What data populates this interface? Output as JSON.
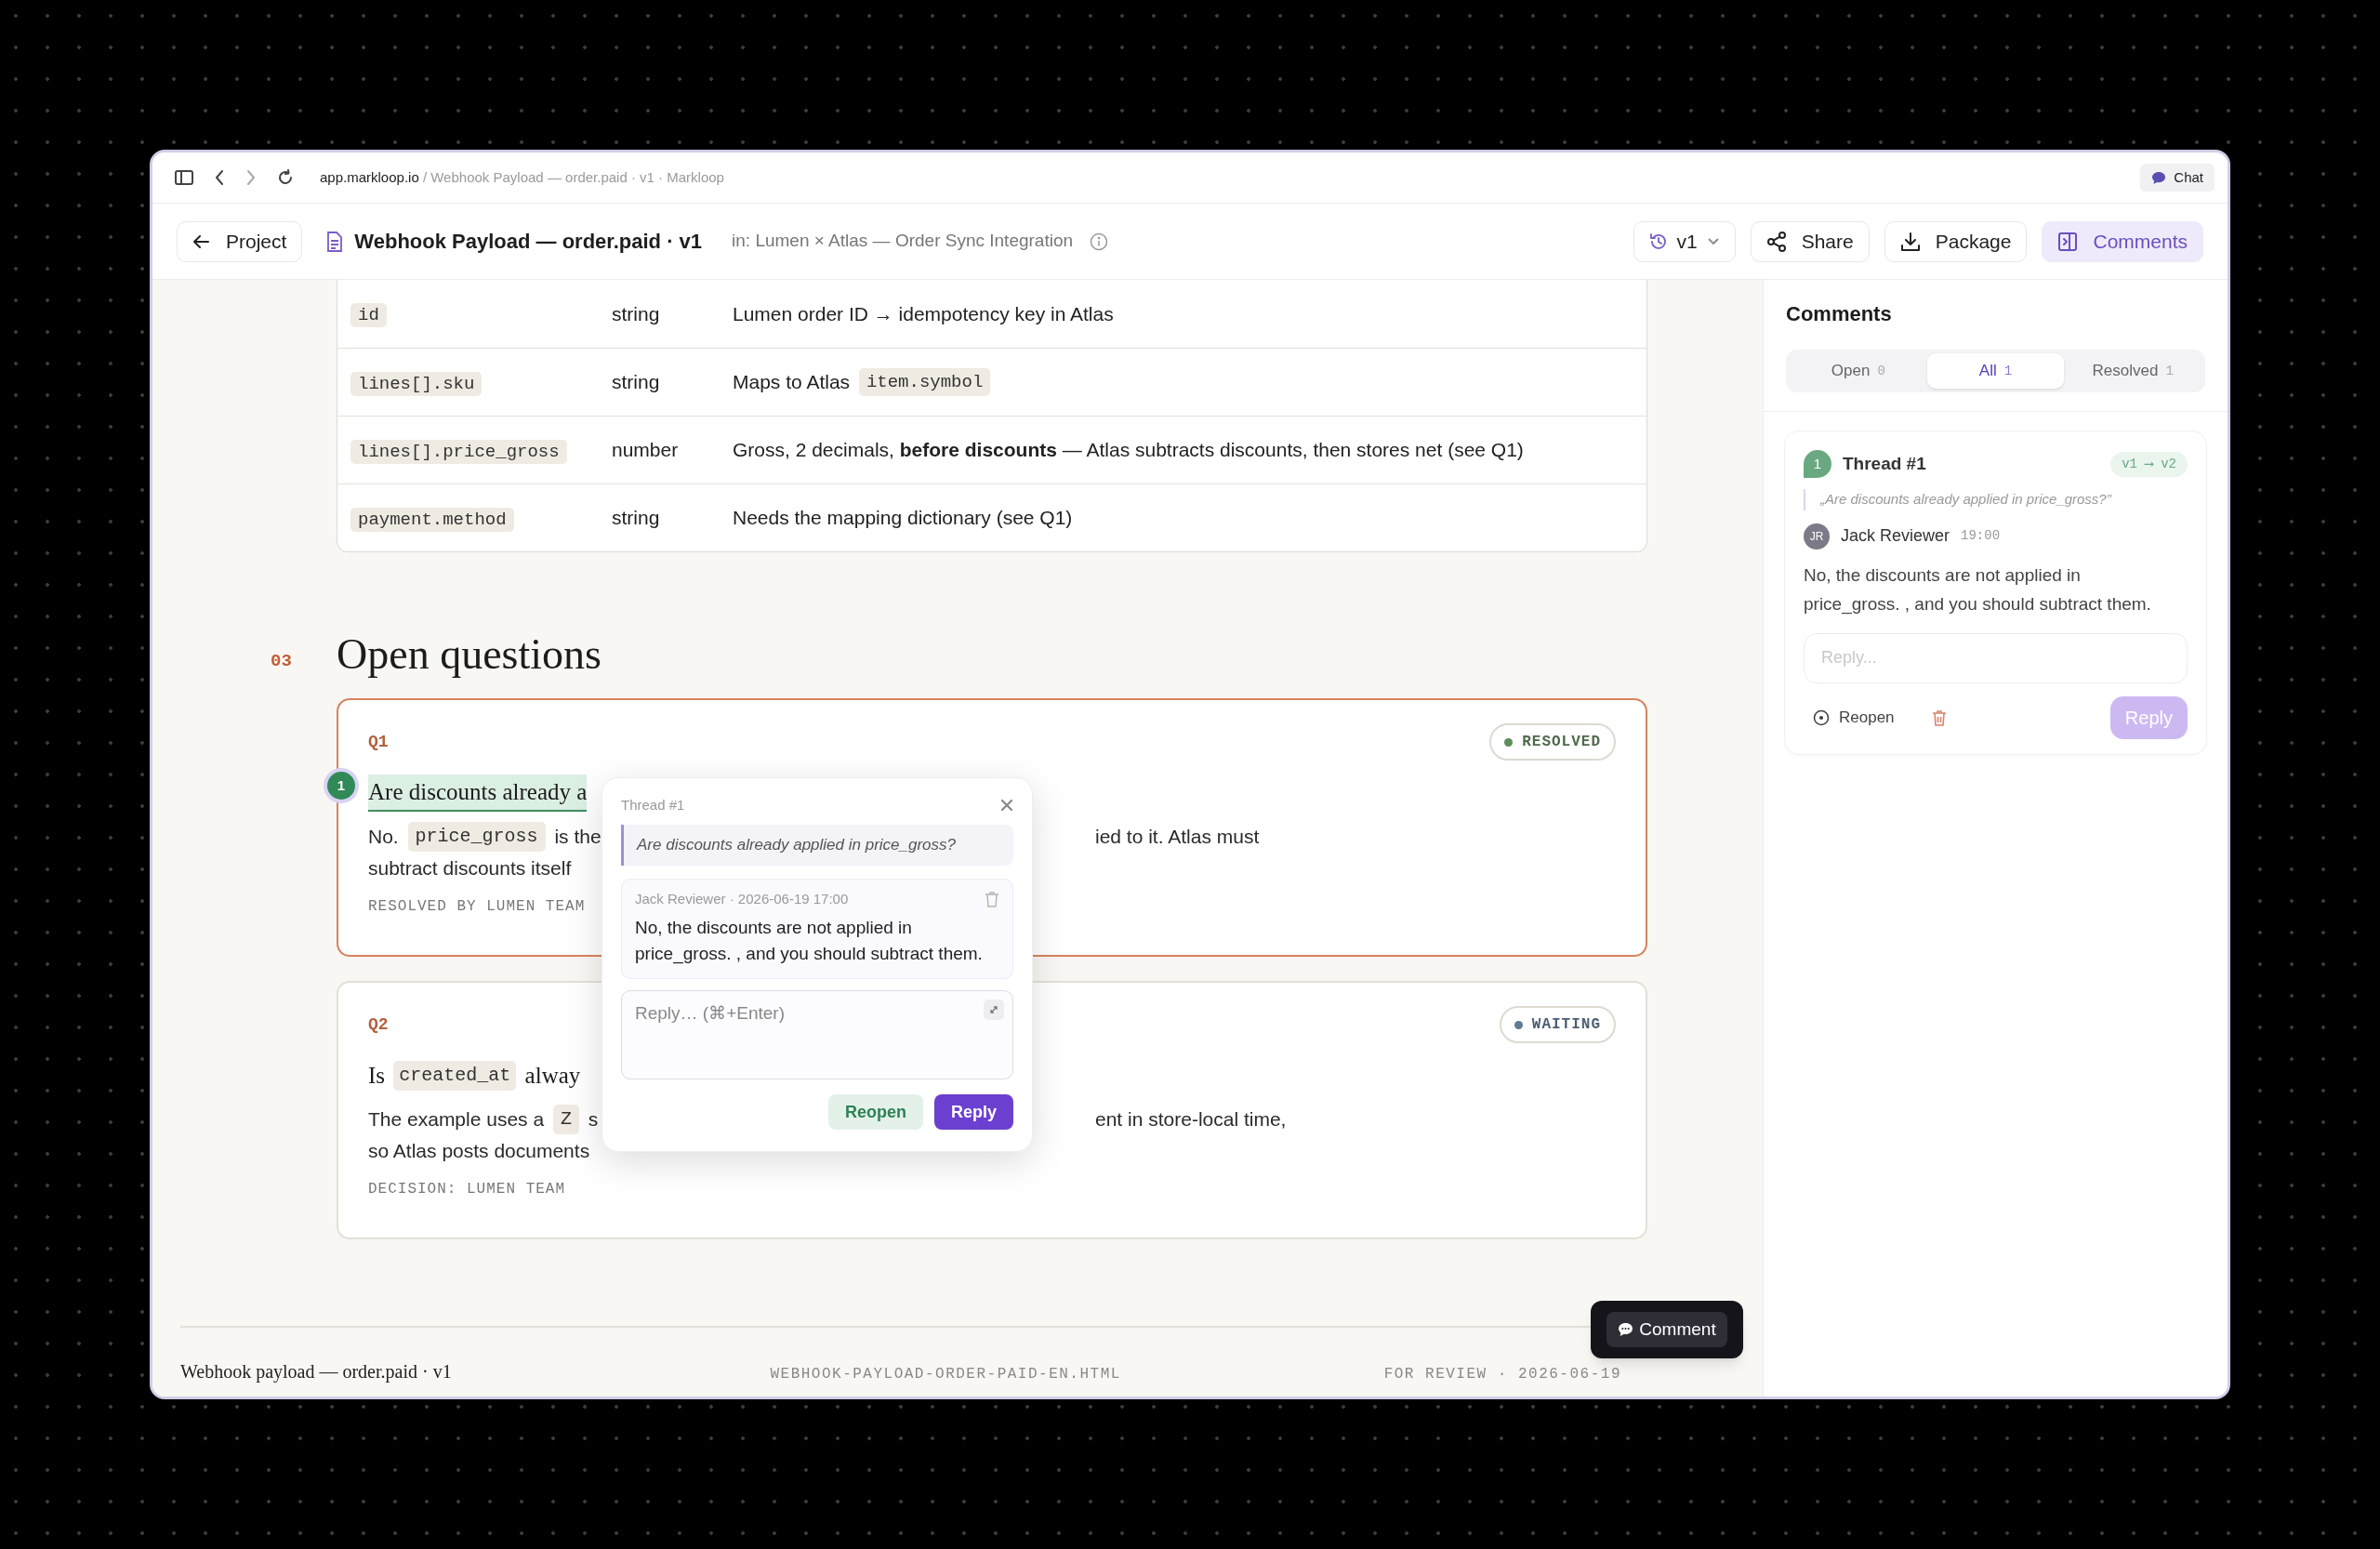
{
  "browser": {
    "host": "app.markloop.io",
    "path": "/ Webhook Payload — order.paid · v1 · Markloop",
    "chat_label": "Chat"
  },
  "header": {
    "back_label": "Project",
    "doc_title": "Webhook Payload — order.paid · v1",
    "context": "in: Lumen × Atlas — Order Sync Integration",
    "version": "v1",
    "actions": [
      {
        "kind": "share",
        "label": "Share",
        "selected": false
      },
      {
        "kind": "package",
        "label": "Package",
        "selected": false
      },
      {
        "kind": "comments",
        "label": "Comments",
        "selected": true
      }
    ]
  },
  "fields_table": {
    "rows": [
      {
        "field": "id",
        "type": "string",
        "description": [
          {
            "text": "Lumen order ID → idempotency key in Atlas"
          }
        ]
      },
      {
        "field": "lines[].sku",
        "type": "string",
        "description": [
          {
            "text": "Maps to Atlas "
          },
          {
            "code": "item.symbol"
          }
        ]
      },
      {
        "field": "lines[].price_gross",
        "type": "number",
        "description": [
          {
            "text": "Gross, 2 decimals, **before discounts** — Atlas subtracts discounts, then stores net (see Q1)"
          }
        ]
      },
      {
        "field": "payment.method",
        "type": "string",
        "description": [
          {
            "text": "Needs the mapping dictionary (see Q1)"
          }
        ]
      }
    ]
  },
  "section": {
    "number": "03",
    "title": "Open questions"
  },
  "questions": [
    {
      "label": "Q1",
      "focused": true,
      "highlighted": true,
      "thread_badge": "1",
      "status": {
        "kind": "resolved",
        "label": "RESOLVED"
      },
      "title": [
        {
          "text": "Are discounts already a"
        }
      ],
      "body": [
        {
          "left": [
            {
              "text": "No. "
            },
            {
              "code": "price_gross"
            },
            {
              "text": " is the"
            }
          ],
          "right": [
            {
              "text": "ied to it. Atlas must"
            }
          ]
        },
        {
          "left": [
            {
              "text": "subtract discounts itself"
            }
          ]
        }
      ],
      "footer": "RESOLVED BY LUMEN TEAM"
    },
    {
      "label": "Q2",
      "focused": false,
      "highlighted": false,
      "status": {
        "kind": "waiting",
        "label": "WAITING"
      },
      "title": [
        {
          "text": "Is "
        },
        {
          "code": "created_at"
        },
        {
          "text": " alway"
        }
      ],
      "body": [
        {
          "left": [
            {
              "text": "The example uses a "
            },
            {
              "code": "Z"
            },
            {
              "text": " s"
            }
          ],
          "right": [
            {
              "text": "ent in store-local time,"
            }
          ]
        },
        {
          "left": [
            {
              "text": "so Atlas posts documents"
            }
          ]
        }
      ],
      "footer": "DECISION: LUMEN TEAM"
    }
  ],
  "footer": {
    "title": "Webhook payload — order.paid · v1",
    "filename": "WEBHOOK-PAYLOAD-ORDER-PAID-EN.HTML",
    "status": "FOR REVIEW · 2026-06-19"
  },
  "floating_comment": {
    "label": "Comment"
  },
  "popup": {
    "title": "Thread #1",
    "quote": "Are discounts already applied in price_gross?",
    "comment_meta": "Jack Reviewer · 2026-06-19 17:00",
    "comment_text": "No, the discounts are not applied in price_gross. , and you should subtract them.",
    "reply_placeholder": "Reply… (⌘+Enter)",
    "buttons": [
      {
        "kind": "secondary",
        "label": "Reopen"
      },
      {
        "kind": "primary",
        "label": "Reply"
      }
    ]
  },
  "sidebar": {
    "title": "Comments",
    "filters": [
      {
        "label": "Open",
        "count": "0",
        "selected": false
      },
      {
        "label": "All",
        "count": "1",
        "selected": true
      },
      {
        "label": "Resolved",
        "count": "1",
        "selected": false
      }
    ],
    "threads": [
      {
        "number": "1",
        "title": "Thread #1",
        "versions": "v1 ⟶ v2",
        "quote": "„Are discounts already applied in price_gross?”",
        "initials": "JR",
        "author": "Jack Reviewer",
        "time": "19:00",
        "text": "No, the discounts are not applied in price_gross. , and you should subtract them.",
        "reply_placeholder": "Reply...",
        "reopen_label": "Reopen",
        "reply_label": "Reply",
        "reply_disabled": true
      }
    ]
  }
}
